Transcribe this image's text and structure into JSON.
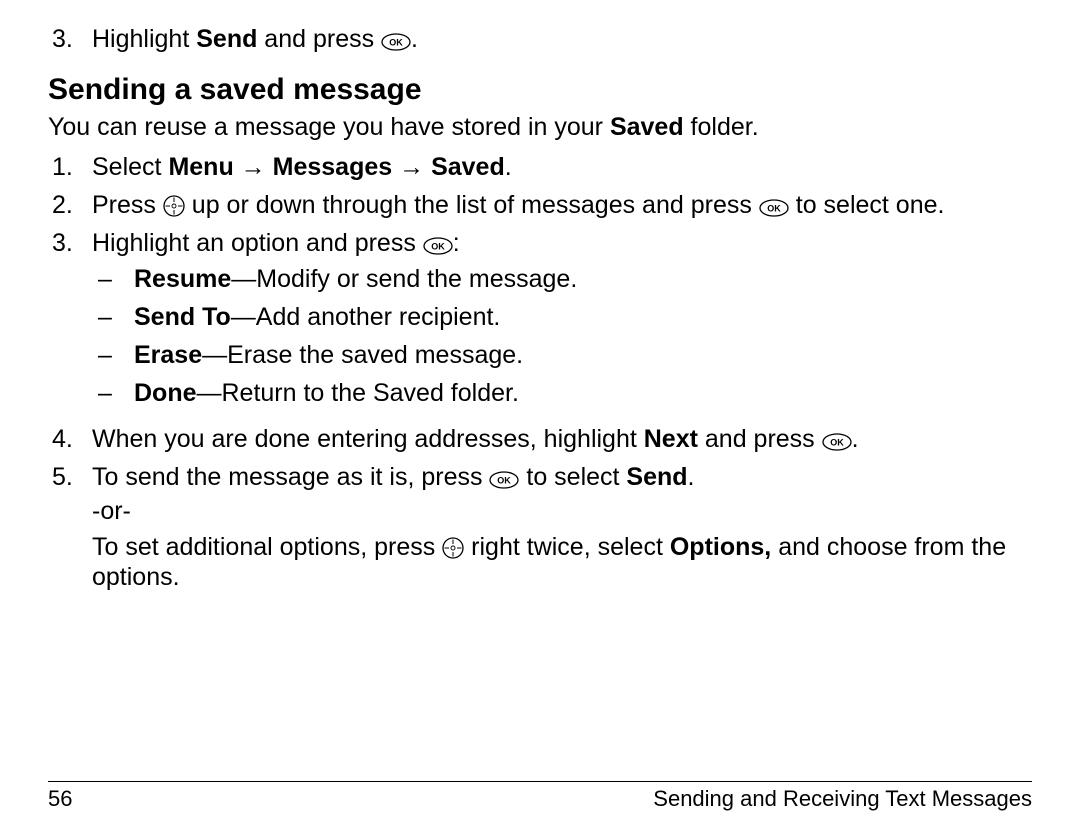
{
  "top_step": {
    "marker": "3.",
    "pre": "Highlight ",
    "bold": "Send",
    "post": " and press ",
    "period": "."
  },
  "heading": "Sending a saved message",
  "intro": {
    "pre": "You can reuse a message you have stored in your ",
    "b": "Saved",
    "post": " folder."
  },
  "steps": {
    "s1": {
      "marker": "1.",
      "pre": "Select ",
      "b1": "Menu",
      "arr1": " → ",
      "b2": "Messages",
      "arr2": " → ",
      "b3": "Saved",
      "period": "."
    },
    "s2": {
      "marker": "2.",
      "pre": "Press ",
      "mid": " up or down through the list of messages and press ",
      "post": " to select one."
    },
    "s3": {
      "marker": "3.",
      "pre": "Highlight an option and press ",
      "post": ":",
      "opts": {
        "a": {
          "dash": "–",
          "b": "Resume",
          "t": "—Modify or send the message."
        },
        "b": {
          "dash": "–",
          "b": "Send To",
          "t": "—Add another recipient."
        },
        "c": {
          "dash": "–",
          "b": "Erase",
          "t": "—Erase the saved message."
        },
        "d": {
          "dash": "–",
          "b": "Done",
          "t": "—Return to the Saved folder."
        }
      }
    },
    "s4": {
      "marker": "4.",
      "pre": "When you are done entering addresses, highlight ",
      "b": "Next",
      "mid": " and press ",
      "period": "."
    },
    "s5": {
      "marker": "5.",
      "line1_pre": "To send the message as it is, press ",
      "line1_mid": " to select ",
      "line1_b": "Send",
      "line1_period": ".",
      "or": "-or-",
      "line2_pre": "To set additional options, press ",
      "line2_mid": " right twice, select ",
      "line2_b": "Options,",
      "line2_post": " and choose from the options."
    }
  },
  "footer": {
    "page": "56",
    "title": "Sending and Receiving Text Messages"
  },
  "icons": {
    "ok": "ok-icon",
    "nav": "nav-icon"
  }
}
